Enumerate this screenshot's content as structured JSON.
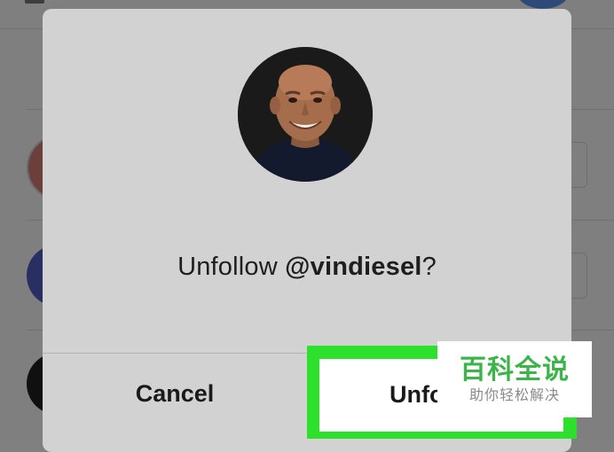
{
  "dialog": {
    "prompt_prefix": "Unfollow ",
    "prompt_handle": "@vindiesel",
    "prompt_suffix": "?",
    "cancel_label": "Cancel",
    "unfollow_label": "Unfollow",
    "profile_photo": "profile-photo"
  },
  "watermark": {
    "title": "百科全说",
    "subtitle": "助你轻松解决"
  },
  "colors": {
    "dialog_bg": "#d2d2d2",
    "overlay_bg": "#7f7f7f",
    "highlight": "#2ce02c",
    "watermark_green": "#3bb54a"
  },
  "icons": {
    "background_top_left": "app-icon",
    "background_top_right": "avatar-icon"
  }
}
